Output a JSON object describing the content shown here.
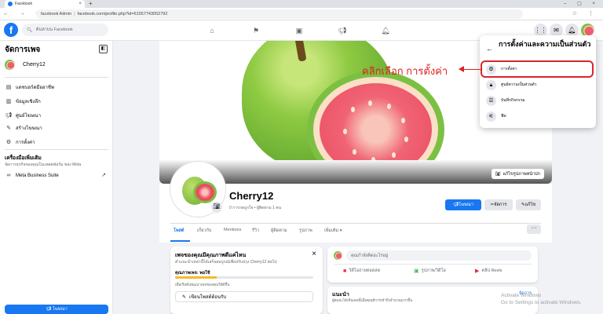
{
  "browser": {
    "tab_title": "Facebook",
    "address_left": "facebook Admin",
    "address_url": "facebook.com/profile.php?id=61557743052792"
  },
  "fb_header": {
    "logo": "f",
    "search_placeholder": "ค้นหาบน Facebook"
  },
  "sidebar": {
    "title": "จัดการเพจ",
    "page_name": "Cherry12",
    "items": [
      {
        "label": "แดชบอร์ดมืออาชีพ",
        "icon": "dashboard-icon"
      },
      {
        "label": "ข้อมูลเชิงลึก",
        "icon": "insights-icon"
      },
      {
        "label": "ศูนย์โฆษณา",
        "icon": "ad-center-icon"
      },
      {
        "label": "สร้างโฆษณา",
        "icon": "create-ad-icon"
      },
      {
        "label": "การตั้งค่า",
        "icon": "gear-icon"
      }
    ],
    "tools_title": "เครื่องมือเพิ่มเติม",
    "tools_sub": "จัดการธุรกิจของคุณในแพลตฟอร์ม ของ Meta",
    "meta_suite": "Meta Business Suite",
    "promote_label": "โฆษณา"
  },
  "cover": {
    "edit_label": "แก้ไขรูปภาพหน้าปก"
  },
  "profile": {
    "name": "Cherry12",
    "meta": "0 การกดถูกใจ • ผู้ติดตาม 1 คน",
    "promote_btn": "โฆษณา",
    "manage_btn": "จัดการ",
    "edit_btn": "แก้ไข",
    "tabs": [
      "โพสต์",
      "เกี่ยวกับ",
      "Mentions",
      "รีวิว",
      "ผู้ติดตาม",
      "รูปภาพ",
      "เพิ่มเติม"
    ]
  },
  "page_health": {
    "title": "เพจของคุณมีคุณภาพดีแค่ไหน",
    "subtitle": "คำแนะนำเหล่านี้ได้เสร็จสมบูรณ์เพื่อปรับปรุง Cherry12 ต่อไป",
    "status_label": "คุณภาพเพจ: พอใช้",
    "progress": 0.3,
    "desc": "เพื่อเริ่มต้นพัฒนาเพจของคุณให้ดีขึ้น",
    "write_post": "เขียนโพสต์ต้อนรับ"
  },
  "composer": {
    "placeholder": "คุณกำลังคิดอะไรอยู่",
    "actions": [
      "วิดีโอถ่ายทอดสด",
      "รูปภาพ/วิดีโอ",
      "คลิป Reels"
    ]
  },
  "recommend": {
    "title": "แนะนำ",
    "subtitle": "ผู้คนจะได้เห็นเพจนี้เมื่อคุณมีการเข้าถึงจำนวนมากขึ้น",
    "manage": "จัดการ"
  },
  "dropdown": {
    "title": "การตั้งค่าและความเป็นส่วนตัว",
    "items": [
      {
        "label": "การตั้งค่า",
        "icon": "gear-icon"
      },
      {
        "label": "ศูนย์ความเป็นส่วนตัว",
        "icon": "lock-icon"
      },
      {
        "label": "บันทึกกิจกรรม",
        "icon": "list-icon"
      },
      {
        "label": "ฟีด",
        "icon": "sliders-icon"
      }
    ]
  },
  "annotation": "คลิกเลือก การตั้งค่า",
  "watermark": [
    "Activate Windows",
    "Go to Settings to activate Windows."
  ],
  "colors": {
    "accent": "#1877f2",
    "highlight": "#d8262d"
  }
}
